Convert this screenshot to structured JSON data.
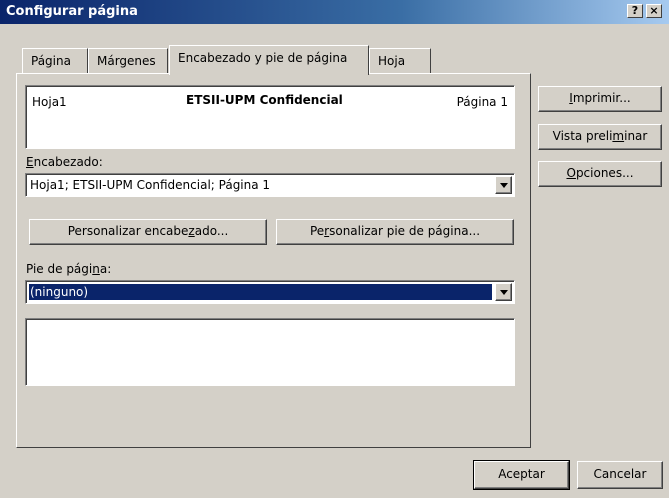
{
  "window": {
    "title": "Configurar página",
    "help_btn": "?",
    "close_btn": "×"
  },
  "tabs": [
    {
      "label": "Página"
    },
    {
      "label": "Márgenes"
    },
    {
      "label": "Encabezado y pie de página"
    },
    {
      "label": "Hoja"
    }
  ],
  "preview": {
    "left": "Hoja1",
    "center": "ETSII-UPM Confidencial",
    "right": "Página 1"
  },
  "header": {
    "label_pre": "",
    "label_key": "E",
    "label_post": "ncabezado:",
    "value": "Hoja1; ETSII-UPM Confidencial; Página 1"
  },
  "custom_header_btn": {
    "pre": "Personalizar encabe",
    "key": "z",
    "post": "ado..."
  },
  "custom_footer_btn": {
    "pre": "Pe",
    "key": "r",
    "post": "sonalizar pie de página..."
  },
  "footer": {
    "label_pre": "Pie de pági",
    "label_key": "n",
    "label_post": "a:",
    "value": "(ninguno)"
  },
  "side_buttons": {
    "print": {
      "pre": "",
      "key": "I",
      "post": "mprimir..."
    },
    "preview": {
      "pre": "Vista preli",
      "key": "m",
      "post": "inar"
    },
    "options": {
      "pre": "",
      "key": "O",
      "post": "pciones..."
    }
  },
  "bottom_buttons": {
    "ok": "Aceptar",
    "cancel": "Cancelar"
  }
}
